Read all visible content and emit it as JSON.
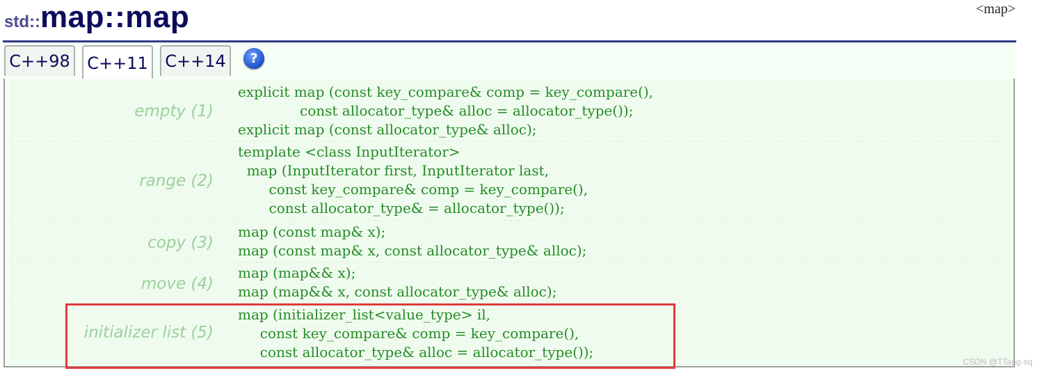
{
  "title": {
    "namespace": "std::",
    "name": "map::map"
  },
  "header_file": "<map>",
  "tabs": [
    {
      "label": "C++98",
      "active": false
    },
    {
      "label": "C++11",
      "active": true
    },
    {
      "label": "C++14",
      "active": false
    }
  ],
  "help_icon": "?",
  "overloads": [
    {
      "label": "empty (1)",
      "code": "explicit map (const key_compare& comp = key_compare(),\n              const allocator_type& alloc = allocator_type());\nexplicit map (const allocator_type& alloc);"
    },
    {
      "label": "range (2)",
      "code": "template <class InputIterator>\n  map (InputIterator first, InputIterator last,\n       const key_compare& comp = key_compare(),\n       const allocator_type& = allocator_type());"
    },
    {
      "label": "copy (3)",
      "code": "map (const map& x);\nmap (const map& x, const allocator_type& alloc);"
    },
    {
      "label": "move (4)",
      "code": "map (map&& x);\nmap (map&& x, const allocator_type& alloc);"
    },
    {
      "label": "initializer list (5)",
      "code": "map (initializer_list<value_type> il,\n     const key_compare& comp = key_compare(),\n     const allocator_type& alloc = allocator_type());"
    }
  ],
  "watermark": "CSDN @TTang-sq",
  "colors": {
    "accent_rule": "#2d3b84",
    "code_green": "#268b26",
    "label_green": "#9ccf9c",
    "highlight_red": "#e23a3a"
  }
}
